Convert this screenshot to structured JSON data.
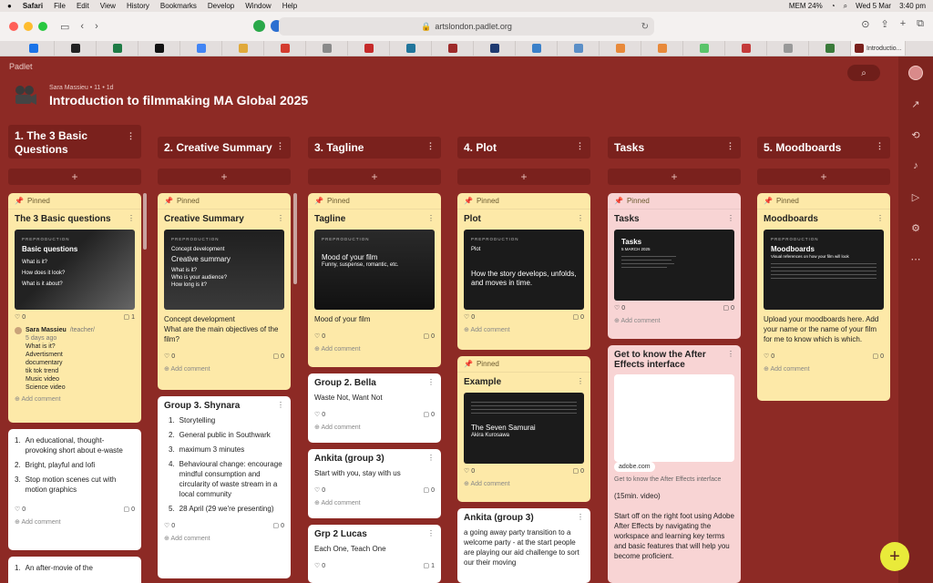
{
  "menubar": {
    "apple": "",
    "app": "Safari",
    "items": [
      "File",
      "Edit",
      "View",
      "History",
      "Bookmarks",
      "Develop",
      "Window",
      "Help"
    ],
    "right": {
      "mem": "MEM 24%",
      "date": "Wed 5 Mar",
      "time": "3:40 pm"
    }
  },
  "browser": {
    "url": "artslondon.padlet.org",
    "active_tab": "Introductio..."
  },
  "padlet": {
    "brand": "Padlet",
    "author": "Sara Massieu • 11 • 1d",
    "title": "Introduction to filmmaking MA Global 2025"
  },
  "columns": [
    {
      "title": "1. The 3 Basic Questions"
    },
    {
      "title": "2. Creative Summary"
    },
    {
      "title": "3. Tagline"
    },
    {
      "title": "4. Plot"
    },
    {
      "title": "Tasks"
    },
    {
      "title": "5. Moodboards"
    }
  ],
  "labels": {
    "pinned": "Pinned",
    "add_comment": "Add comment",
    "add": "+"
  },
  "cards": {
    "c1": {
      "title": "The 3 Basic questions",
      "thumb_small": "PREPRODUCTION",
      "thumb_big": "Basic questions",
      "thumb_l1": "What is it?",
      "thumb_l2": "How does it look?",
      "thumb_l3": "What is it about?",
      "likes": "0",
      "comments": "1",
      "comment_author": "Sara Massieu",
      "comment_role": "/teacher/",
      "comment_time": "5 days ago",
      "comment_lines": [
        "What is it?",
        "Advertisment",
        "documentary",
        "tik tok trend",
        "Music video",
        "Science video"
      ]
    },
    "c1b": {
      "items": [
        "An educational, thought-provoking short about e-waste",
        "Bright, playful and lofi",
        "Stop motion scenes cut with motion graphics"
      ],
      "likes": "0",
      "comments": "0"
    },
    "c1c": {
      "first": "An after-movie of the"
    },
    "c2": {
      "title": "Creative Summary",
      "thumb_small": "PREPRODUCTION",
      "thumb_big": "Creative summary",
      "thumb_pre": "Concept development",
      "thumb_l1": "What is it?",
      "thumb_l2": "Who is your audience?",
      "thumb_l3": "How long is it?",
      "body": "Concept development\nWhat are the main objectives of the film?",
      "likes": "0",
      "comments": "0"
    },
    "c2b": {
      "title": "Group 3. Shynara",
      "items": [
        "Storytelling",
        "General public in Southwark",
        "maximum 3 minutes",
        "Behavioural change: encourage mindful consumption and circularity of waste stream in a local community",
        "28 April (29 we're presenting)"
      ],
      "likes": "0",
      "comments": "0"
    },
    "c3": {
      "title": "Tagline",
      "thumb_small": "PREPRODUCTION",
      "thumb_big": "Mood of your film",
      "thumb_sub": "Funny, suspense, romantic, etc.",
      "body": "Mood of your film",
      "likes": "0",
      "comments": "0"
    },
    "c3b": {
      "title": "Group 2. Bella",
      "body": "Waste Not, Want Not",
      "likes": "0",
      "comments": "0"
    },
    "c3c": {
      "title": "Ankita (group 3)",
      "body": "Start with you, stay with us",
      "likes": "0",
      "comments": "0"
    },
    "c3d": {
      "title": "Grp 2 Lucas",
      "body": "Each One, Teach One",
      "likes": "0",
      "comments": "1"
    },
    "c4": {
      "title": "Plot",
      "thumb_small": "PREPRODUCTION",
      "thumb_big": "How the story develops, unfolds, and moves in time.",
      "thumb_pre": "Plot",
      "likes": "0",
      "comments": "0"
    },
    "c4b": {
      "title": "Example",
      "thumb_big": "The Seven Samurai",
      "thumb_sub": "Akira Kurosawa",
      "likes": "0",
      "comments": "0"
    },
    "c4c": {
      "title": "Ankita (group 3)",
      "body": "a going away party transition to a welcome party - at the start people are playing our aid challenge to sort our their moving"
    },
    "c5": {
      "title": "Tasks",
      "thumb_big": "Tasks",
      "thumb_date": "5 MARCH 2025",
      "likes": "0",
      "comments": "0"
    },
    "c5b": {
      "title": "Get to know the After Effects interface",
      "link_domain": "adobe.com",
      "link_title": "Get to know the After Effects interface",
      "body1": "(15min. video)",
      "body2": "Start off on the right foot using Adobe After Effects by navigating the workspace and learning key terms and basic features that will help you become proficient."
    },
    "c6": {
      "title": "Moodboards",
      "thumb_small": "PREPRODUCTION",
      "thumb_big": "Moodboards",
      "thumb_sub": "Visual references on how your film will look",
      "body": "Upload your moodboards here. Add your name or the name of your film for me to know which is which.",
      "likes": "0",
      "comments": "0"
    }
  },
  "colors": {
    "bg": "#8d2a25",
    "pinned_yellow": "#fde9a8",
    "pink": "#f8d4d4",
    "fab": "#e9ea3a"
  }
}
